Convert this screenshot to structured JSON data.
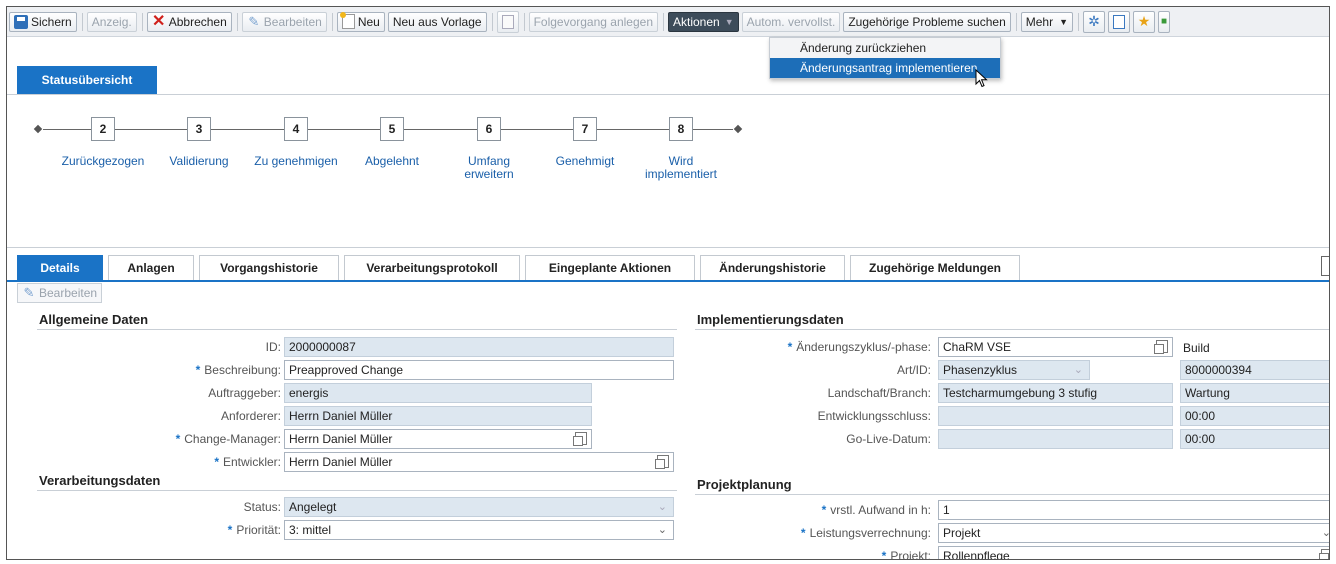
{
  "toolbar": {
    "save": "Sichern",
    "display": "Anzeig.",
    "cancel": "Abbrechen",
    "edit": "Bearbeiten",
    "new": "Neu",
    "new_from_template": "Neu aus Vorlage",
    "followup": "Folgevorgang anlegen",
    "actions": "Aktionen",
    "autocomplete": "Autom. vervollst.",
    "related_problems": "Zugehörige Probleme suchen",
    "more": "Mehr"
  },
  "actions_menu": {
    "items": [
      "Änderung zurückziehen",
      "Änderungsantrag implementieren"
    ]
  },
  "status": {
    "tab_label": "Statusübersicht",
    "steps": [
      {
        "number": "2",
        "label": "Zurückgezogen"
      },
      {
        "number": "3",
        "label": "Validierung"
      },
      {
        "number": "4",
        "label": "Zu genehmigen"
      },
      {
        "number": "5",
        "label": "Abgelehnt"
      },
      {
        "number": "6",
        "label": "Umfang erweitern"
      },
      {
        "number": "7",
        "label": "Genehmigt"
      },
      {
        "number": "8",
        "label": "Wird implementiert"
      }
    ]
  },
  "tabs": [
    "Details",
    "Anlagen",
    "Vorgangshistorie",
    "Verarbeitungsprotokoll",
    "Eingeplante Aktionen",
    "Änderungshistorie",
    "Zugehörige Meldungen"
  ],
  "details_edit": "Bearbeiten",
  "general": {
    "title": "Allgemeine Daten",
    "id_label": "ID:",
    "id": "2000000087",
    "desc_label": "Beschreibung:",
    "desc": "Preapproved Change",
    "client_label": "Auftraggeber:",
    "client": "energis",
    "requester_label": "Anforderer:",
    "requester": "Herrn Daniel Müller",
    "cm_label": "Change-Manager:",
    "cm": "Herrn Daniel Müller",
    "dev_label": "Entwickler:",
    "dev": "Herrn Daniel Müller"
  },
  "processing": {
    "title": "Verarbeitungsdaten",
    "status_label": "Status:",
    "status": "Angelegt",
    "prio_label": "Priorität:",
    "prio": "3: mittel"
  },
  "implementation": {
    "title": "Implementierungsdaten",
    "cycle_label": "Änderungszyklus/-phase:",
    "cycle": "ChaRM VSE",
    "type_label": "Art/ID:",
    "type": "Phasenzyklus",
    "landscape_label": "Landschaft/Branch:",
    "landscape": "Testcharmumgebung 3 stufig",
    "devend_label": "Entwicklungsschluss:",
    "devend": "",
    "golive_label": "Go-Live-Datum:",
    "golive": "",
    "build_label": "Build",
    "build": "8000000394",
    "maintenance": "Wartung",
    "time1": "00:00",
    "time2": "00:00"
  },
  "project": {
    "title": "Projektplanung",
    "effort_label": "vrstl. Aufwand in h:",
    "effort": "1",
    "billing_label": "Leistungsverrechnung:",
    "billing": "Projekt",
    "project_label": "Projekt:",
    "project": "Rollenpflege"
  },
  "colors": {
    "accent": "#1a73c6",
    "toolbar": "#eef0f3",
    "readonly_field": "#dde7f0",
    "cancel": "#d0201b"
  }
}
